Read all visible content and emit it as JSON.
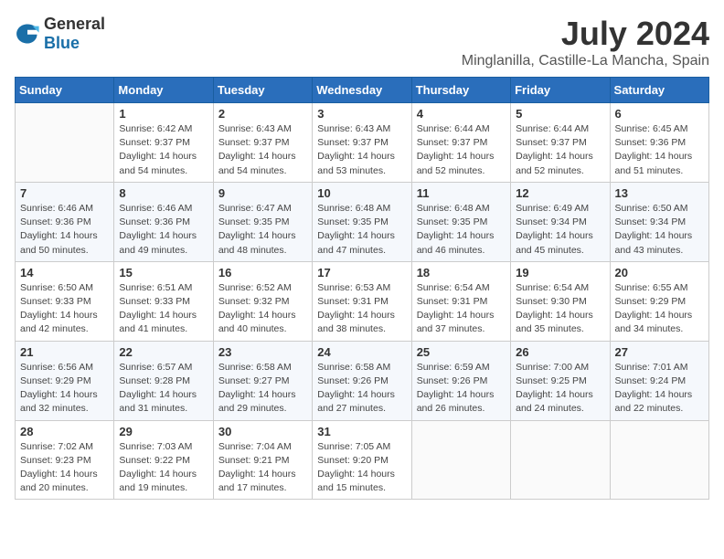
{
  "logo": {
    "text_general": "General",
    "text_blue": "Blue"
  },
  "title": "July 2024",
  "subtitle": "Minglanilla, Castille-La Mancha, Spain",
  "days_of_week": [
    "Sunday",
    "Monday",
    "Tuesday",
    "Wednesday",
    "Thursday",
    "Friday",
    "Saturday"
  ],
  "weeks": [
    [
      {
        "day": "",
        "info": ""
      },
      {
        "day": "1",
        "info": "Sunrise: 6:42 AM\nSunset: 9:37 PM\nDaylight: 14 hours\nand 54 minutes."
      },
      {
        "day": "2",
        "info": "Sunrise: 6:43 AM\nSunset: 9:37 PM\nDaylight: 14 hours\nand 54 minutes."
      },
      {
        "day": "3",
        "info": "Sunrise: 6:43 AM\nSunset: 9:37 PM\nDaylight: 14 hours\nand 53 minutes."
      },
      {
        "day": "4",
        "info": "Sunrise: 6:44 AM\nSunset: 9:37 PM\nDaylight: 14 hours\nand 52 minutes."
      },
      {
        "day": "5",
        "info": "Sunrise: 6:44 AM\nSunset: 9:37 PM\nDaylight: 14 hours\nand 52 minutes."
      },
      {
        "day": "6",
        "info": "Sunrise: 6:45 AM\nSunset: 9:36 PM\nDaylight: 14 hours\nand 51 minutes."
      }
    ],
    [
      {
        "day": "7",
        "info": "Sunrise: 6:46 AM\nSunset: 9:36 PM\nDaylight: 14 hours\nand 50 minutes."
      },
      {
        "day": "8",
        "info": "Sunrise: 6:46 AM\nSunset: 9:36 PM\nDaylight: 14 hours\nand 49 minutes."
      },
      {
        "day": "9",
        "info": "Sunrise: 6:47 AM\nSunset: 9:35 PM\nDaylight: 14 hours\nand 48 minutes."
      },
      {
        "day": "10",
        "info": "Sunrise: 6:48 AM\nSunset: 9:35 PM\nDaylight: 14 hours\nand 47 minutes."
      },
      {
        "day": "11",
        "info": "Sunrise: 6:48 AM\nSunset: 9:35 PM\nDaylight: 14 hours\nand 46 minutes."
      },
      {
        "day": "12",
        "info": "Sunrise: 6:49 AM\nSunset: 9:34 PM\nDaylight: 14 hours\nand 45 minutes."
      },
      {
        "day": "13",
        "info": "Sunrise: 6:50 AM\nSunset: 9:34 PM\nDaylight: 14 hours\nand 43 minutes."
      }
    ],
    [
      {
        "day": "14",
        "info": "Sunrise: 6:50 AM\nSunset: 9:33 PM\nDaylight: 14 hours\nand 42 minutes."
      },
      {
        "day": "15",
        "info": "Sunrise: 6:51 AM\nSunset: 9:33 PM\nDaylight: 14 hours\nand 41 minutes."
      },
      {
        "day": "16",
        "info": "Sunrise: 6:52 AM\nSunset: 9:32 PM\nDaylight: 14 hours\nand 40 minutes."
      },
      {
        "day": "17",
        "info": "Sunrise: 6:53 AM\nSunset: 9:31 PM\nDaylight: 14 hours\nand 38 minutes."
      },
      {
        "day": "18",
        "info": "Sunrise: 6:54 AM\nSunset: 9:31 PM\nDaylight: 14 hours\nand 37 minutes."
      },
      {
        "day": "19",
        "info": "Sunrise: 6:54 AM\nSunset: 9:30 PM\nDaylight: 14 hours\nand 35 minutes."
      },
      {
        "day": "20",
        "info": "Sunrise: 6:55 AM\nSunset: 9:29 PM\nDaylight: 14 hours\nand 34 minutes."
      }
    ],
    [
      {
        "day": "21",
        "info": "Sunrise: 6:56 AM\nSunset: 9:29 PM\nDaylight: 14 hours\nand 32 minutes."
      },
      {
        "day": "22",
        "info": "Sunrise: 6:57 AM\nSunset: 9:28 PM\nDaylight: 14 hours\nand 31 minutes."
      },
      {
        "day": "23",
        "info": "Sunrise: 6:58 AM\nSunset: 9:27 PM\nDaylight: 14 hours\nand 29 minutes."
      },
      {
        "day": "24",
        "info": "Sunrise: 6:58 AM\nSunset: 9:26 PM\nDaylight: 14 hours\nand 27 minutes."
      },
      {
        "day": "25",
        "info": "Sunrise: 6:59 AM\nSunset: 9:26 PM\nDaylight: 14 hours\nand 26 minutes."
      },
      {
        "day": "26",
        "info": "Sunrise: 7:00 AM\nSunset: 9:25 PM\nDaylight: 14 hours\nand 24 minutes."
      },
      {
        "day": "27",
        "info": "Sunrise: 7:01 AM\nSunset: 9:24 PM\nDaylight: 14 hours\nand 22 minutes."
      }
    ],
    [
      {
        "day": "28",
        "info": "Sunrise: 7:02 AM\nSunset: 9:23 PM\nDaylight: 14 hours\nand 20 minutes."
      },
      {
        "day": "29",
        "info": "Sunrise: 7:03 AM\nSunset: 9:22 PM\nDaylight: 14 hours\nand 19 minutes."
      },
      {
        "day": "30",
        "info": "Sunrise: 7:04 AM\nSunset: 9:21 PM\nDaylight: 14 hours\nand 17 minutes."
      },
      {
        "day": "31",
        "info": "Sunrise: 7:05 AM\nSunset: 9:20 PM\nDaylight: 14 hours\nand 15 minutes."
      },
      {
        "day": "",
        "info": ""
      },
      {
        "day": "",
        "info": ""
      },
      {
        "day": "",
        "info": ""
      }
    ]
  ]
}
